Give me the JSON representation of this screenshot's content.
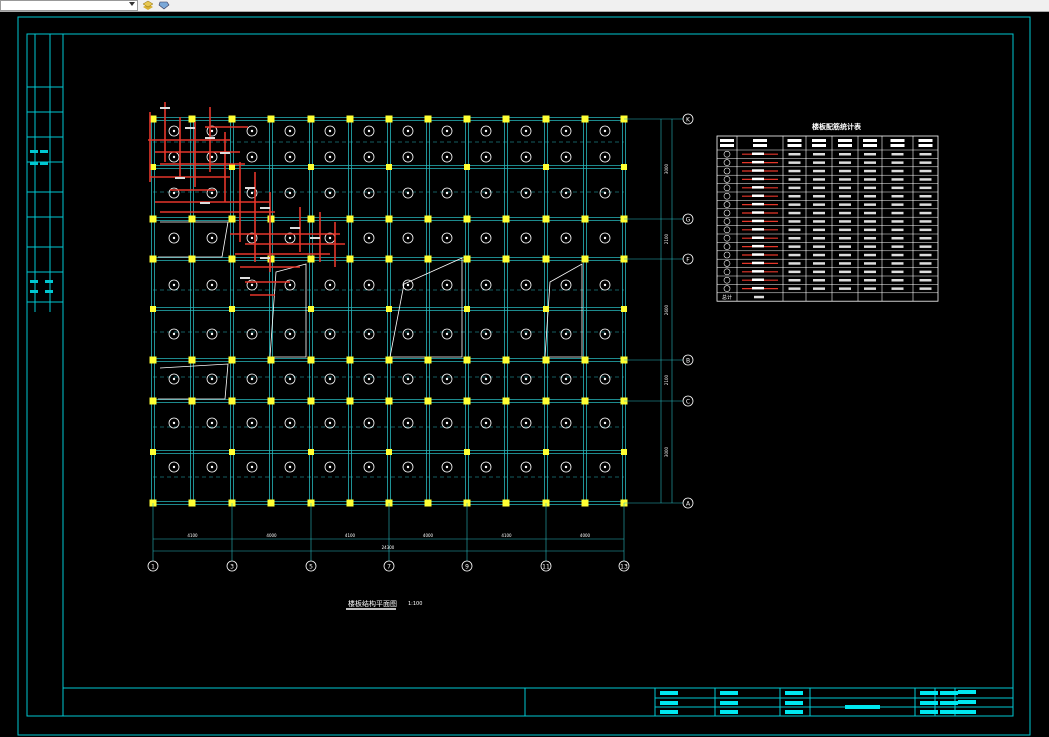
{
  "toolbar": {
    "layer_icon": "layer-icon",
    "properties_icon": "properties-icon"
  },
  "colors": {
    "background": "#000000",
    "frame": "#00c8d2",
    "grid": "#27b8bd",
    "column": "#ffff33",
    "rebar": "#e5362a",
    "text": "#ffffff",
    "stamp": "#00e8f0"
  },
  "axes": {
    "x_labels": [
      "1",
      "3",
      "5",
      "7",
      "9",
      "11",
      "13"
    ],
    "y_labels": [
      "K",
      "G",
      "F",
      "B",
      "C",
      "A"
    ],
    "bay_dims": [
      "4100",
      "4000",
      "4100",
      "4000",
      "4100",
      "4000"
    ],
    "total_dim": "24300",
    "span_dims": [
      "3000",
      "2100",
      "2600",
      "2100",
      "3000"
    ]
  },
  "drawing": {
    "title": "楼板结构平面图",
    "scale": "1:100"
  },
  "slab_table": {
    "title": "楼板配筋统计表",
    "headers": [
      "编号",
      "配筋简图",
      "规格",
      "每根长度",
      "单根长度",
      "根数",
      "总长度",
      "总重量"
    ],
    "rows": 17,
    "total_label": "总计"
  }
}
